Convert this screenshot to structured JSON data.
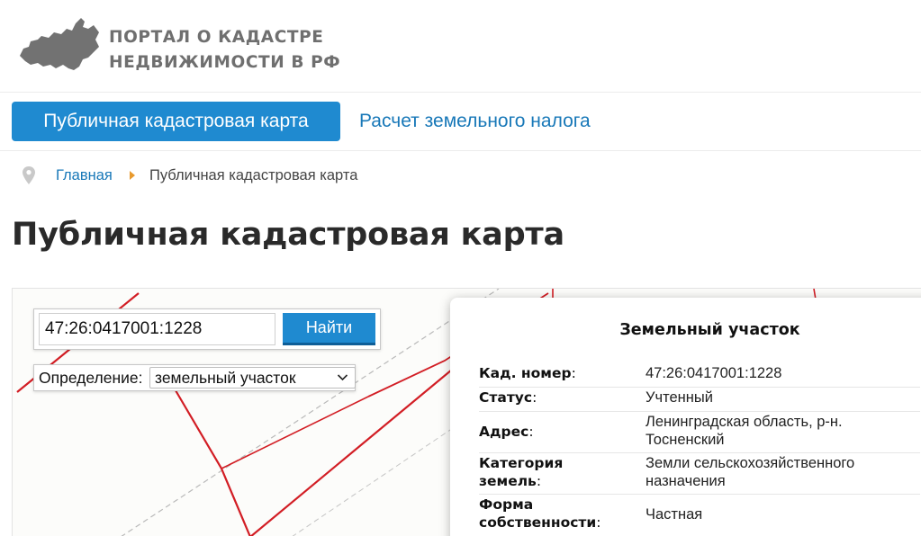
{
  "header": {
    "brand_line1": "ПОРТАЛ О КАДАСТРЕ",
    "brand_line2": "НЕДВИЖИМОСТИ В РФ",
    "logo_icon": "russia-map-icon",
    "logo_color": "#707070"
  },
  "nav": {
    "active_label": "Публичная кадастровая карта",
    "link_label": "Расчет земельного налога",
    "accent_color": "#1f8ad0"
  },
  "breadcrumb": {
    "home": "Главная",
    "current": "Публичная кадастровая карта"
  },
  "page": {
    "title": "Публичная кадастровая карта"
  },
  "search": {
    "value": "47:26:0417001:1228",
    "button_label": "Найти",
    "definition_label": "Определение:",
    "definition_selected": "земельный участок"
  },
  "panel": {
    "title": "Земельный участок",
    "rows": [
      {
        "key": "Кад. номер",
        "value": "47:26:0417001:1228"
      },
      {
        "key": "Статус",
        "value": "Учтенный"
      },
      {
        "key": "Адрес",
        "value_line1": "Ленинградская область, р-н.",
        "value_line2": "Тосненский"
      },
      {
        "key_line1": "Категория",
        "key_line2": "земель",
        "value_line1": "Земли сельскохозяйственного",
        "value_line2": "назначения"
      },
      {
        "key_line1": "Форма",
        "key_line2": "собственности",
        "value": "Частная"
      }
    ]
  }
}
